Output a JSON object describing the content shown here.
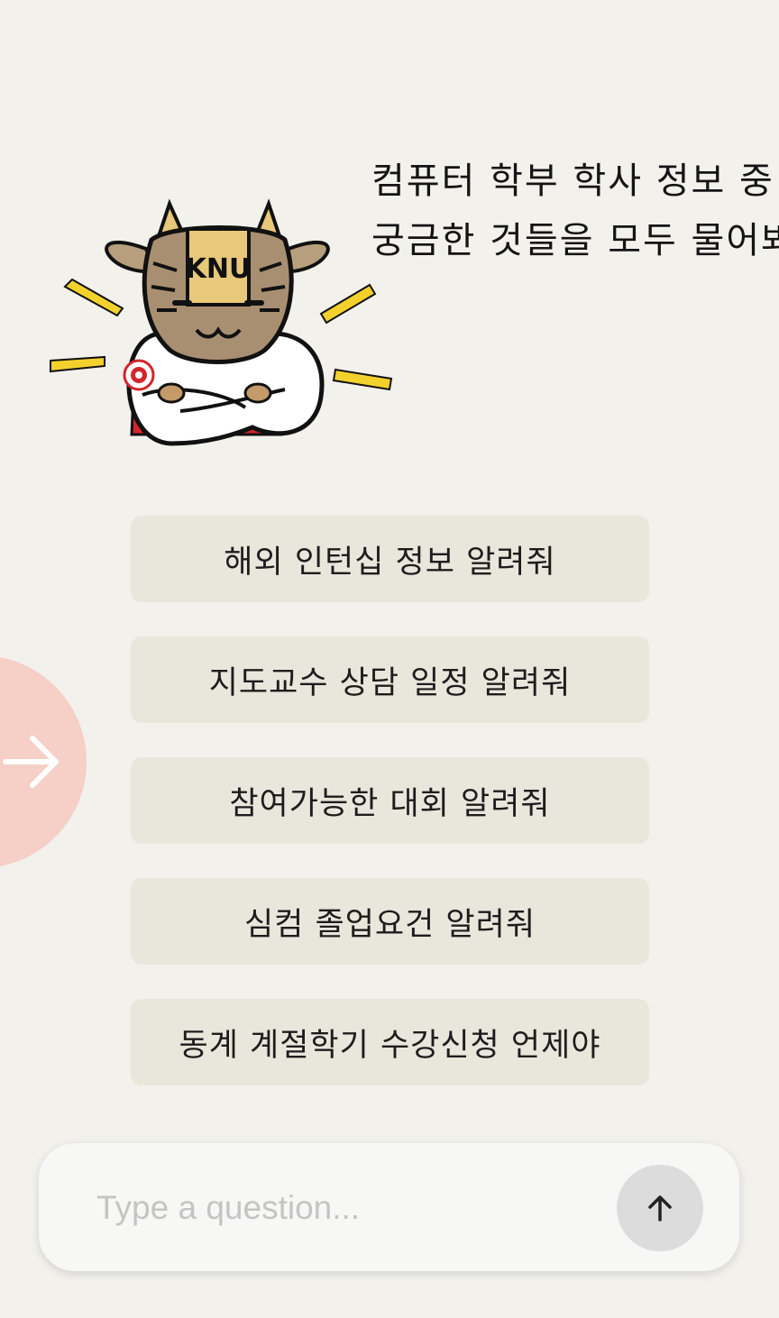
{
  "greeting": {
    "line1": "컴퓨터 학부 학사 정보 중",
    "line2": "궁금한 것들을 모두 물어봐!!"
  },
  "mascot": {
    "icon": "cow-mascot-icon",
    "face_text": "KNU"
  },
  "side_button": {
    "icon": "arrow-right-icon"
  },
  "suggestions": [
    "해외 인턴십 정보 알려줘",
    "지도교수 상담 일정 알려줘",
    "참여가능한 대회 알려줘",
    "심컴 졸업요건 알려줘",
    "동계 계절학기 수강신청 언제야"
  ],
  "input": {
    "placeholder": "Type a question...",
    "value": ""
  },
  "send_button": {
    "icon": "arrow-up-icon"
  },
  "colors": {
    "background": "#f2f1ec",
    "chip": "#e9e6dc",
    "side_button": "#f6cfc7",
    "send_button": "#dcdcdc"
  }
}
